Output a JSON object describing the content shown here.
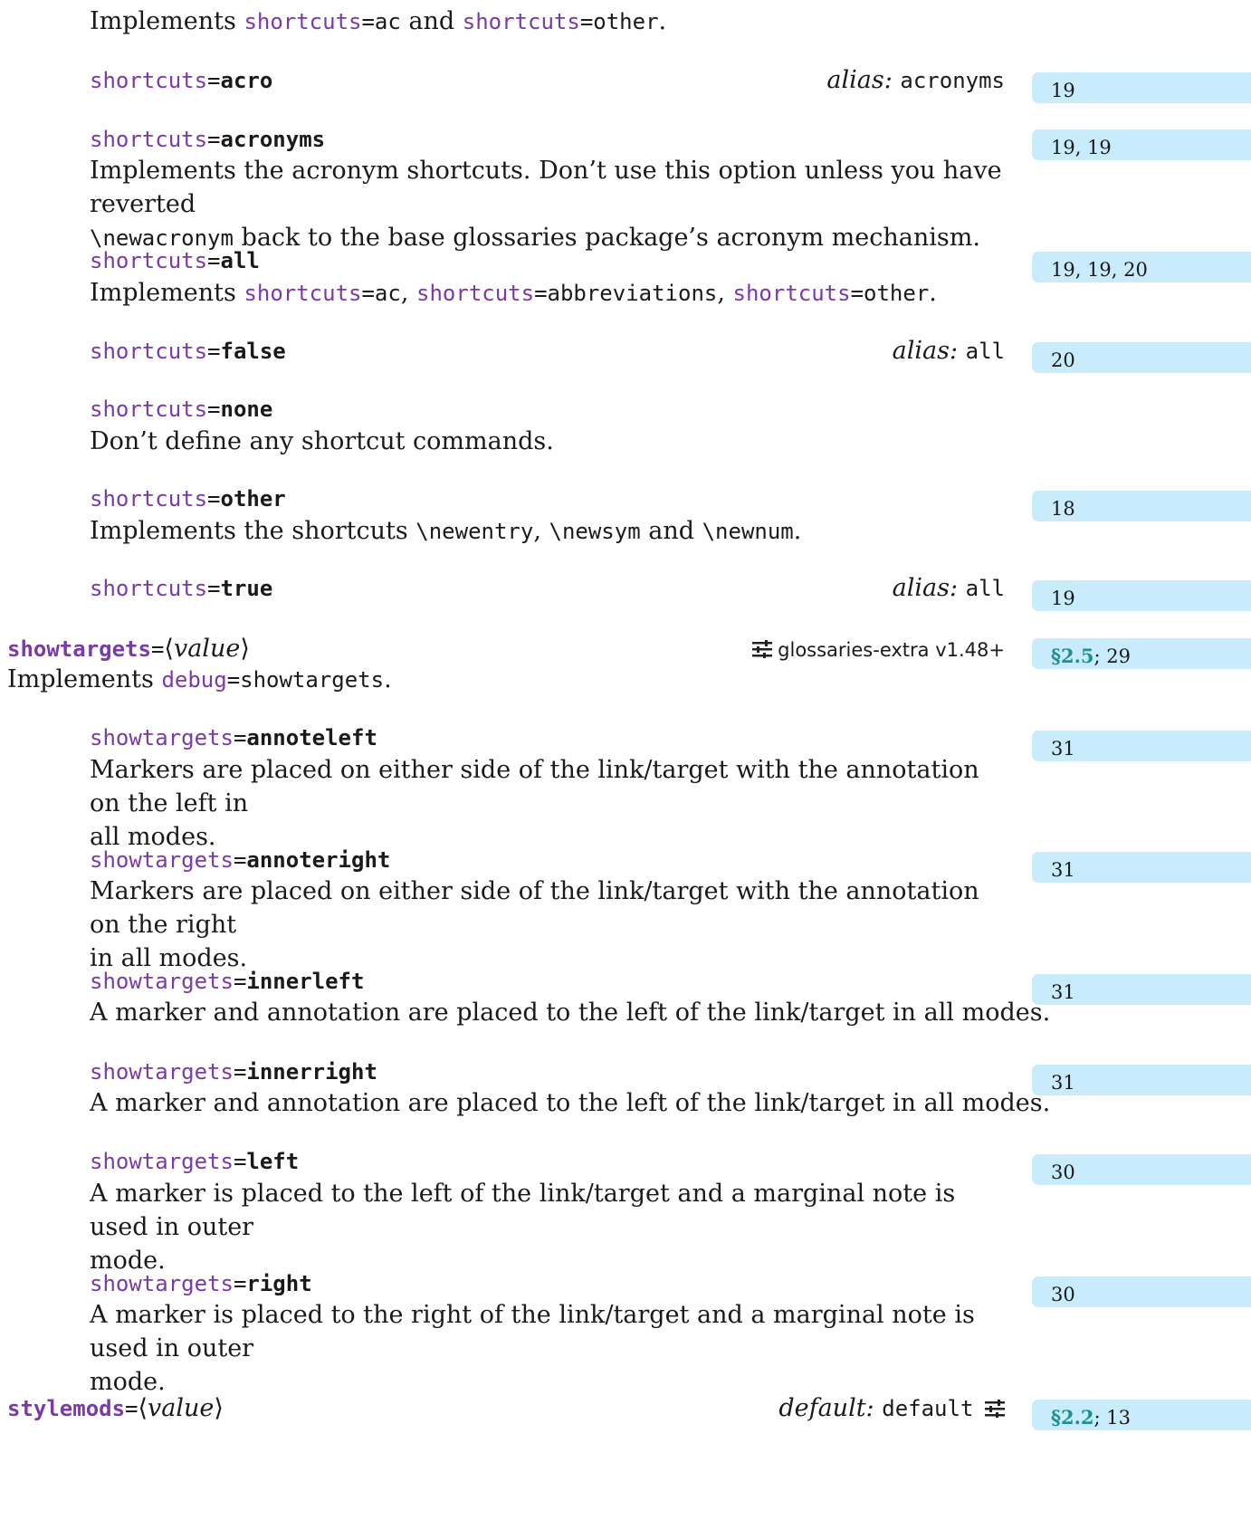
{
  "top": {
    "text_a": "Implements ",
    "link_a": "shortcuts",
    "val_a": "=ac",
    "text_b": " and ",
    "link_b": "shortcuts",
    "val_b": "=other",
    "text_c": "."
  },
  "shortcuts_acro": {
    "key": "shortcuts",
    "eq": "=",
    "value": "acro",
    "alias_label": "alias:",
    "alias_value": "acronyms",
    "pages": "19"
  },
  "shortcuts_acronyms": {
    "key": "shortcuts",
    "eq": "=",
    "value": "acronyms",
    "pages": "19, 19",
    "desc_1": "Implements the acronym shortcuts. Don’t use this option unless you have reverted",
    "desc_2_cmd": "\\newacronym",
    "desc_2_rest": " back to the base glossaries package’s acronym mechanism."
  },
  "shortcuts_all": {
    "key": "shortcuts",
    "eq": "=",
    "value": "all",
    "pages": "19, 19, 20",
    "desc_pre": "Implements ",
    "l1": "shortcuts",
    "v1": "=ac",
    "sep1": ", ",
    "l2": "shortcuts",
    "v2": "=abbreviations",
    "sep2": ", ",
    "l3": "shortcuts",
    "v3": "=other",
    "end": "."
  },
  "shortcuts_false": {
    "key": "shortcuts",
    "eq": "=",
    "value": "false",
    "alias_label": "alias:",
    "alias_value": "all",
    "pages": "20"
  },
  "shortcuts_none": {
    "key": "shortcuts",
    "eq": "=",
    "value": "none",
    "desc": "Don’t define any shortcut commands."
  },
  "shortcuts_other": {
    "key": "shortcuts",
    "eq": "=",
    "value": "other",
    "pages": "18",
    "desc_pre": "Implements the shortcuts ",
    "c1": "\\newentry",
    "sep1": ", ",
    "c2": "\\newsym",
    "sep2": " and ",
    "c3": "\\newnum",
    "end": "."
  },
  "shortcuts_true": {
    "key": "shortcuts",
    "eq": "=",
    "value": "true",
    "alias_label": "alias:",
    "alias_value": "all",
    "pages": "19"
  },
  "showtargets": {
    "key": "showtargets",
    "eq": "=",
    "lang": "⟨",
    "arg": "value",
    "rang": "⟩",
    "package_note": "glossaries-extra v1.48+",
    "section": "§2.5",
    "pages": "; 29",
    "desc_pre": "Implements ",
    "link": "debug",
    "val": "=showtargets",
    "end": "."
  },
  "st_annoteleft": {
    "key": "showtargets",
    "eq": "=",
    "value": "annoteleft",
    "pages": "31",
    "desc_1": "Markers are placed on either side of the link/target with the annotation on the left in",
    "desc_2": "all modes."
  },
  "st_annoteright": {
    "key": "showtargets",
    "eq": "=",
    "value": "annoteright",
    "pages": "31",
    "desc_1": "Markers are placed on either side of the link/target with the annotation on the right",
    "desc_2": "in all modes."
  },
  "st_innerleft": {
    "key": "showtargets",
    "eq": "=",
    "value": "innerleft",
    "pages": "31",
    "desc": "A marker and annotation are placed to the left of the link/target in all modes."
  },
  "st_innerright": {
    "key": "showtargets",
    "eq": "=",
    "value": "innerright",
    "pages": "31",
    "desc": "A marker and annotation are placed to the left of the link/target in all modes."
  },
  "st_left": {
    "key": "showtargets",
    "eq": "=",
    "value": "left",
    "pages": "30",
    "desc_1": "A marker is placed to the left of the link/target and a marginal note is used in outer",
    "desc_2": "mode."
  },
  "st_right": {
    "key": "showtargets",
    "eq": "=",
    "value": "right",
    "pages": "30",
    "desc_1": "A marker is placed to the right of the link/target and a marginal note is used in outer",
    "desc_2": "mode."
  },
  "stylemods": {
    "key": "stylemods",
    "eq": "=",
    "lang": "⟨",
    "arg": "value",
    "rang": "⟩",
    "default_label": "default:",
    "default_value": "default",
    "section": "§2.2",
    "pages": "; 13"
  },
  "icons": {
    "option_icon": "sliders-icon"
  },
  "colors": {
    "link": "#7b3aa6",
    "margin_bg": "#c8ecfb",
    "section": "#1f8f8f"
  }
}
